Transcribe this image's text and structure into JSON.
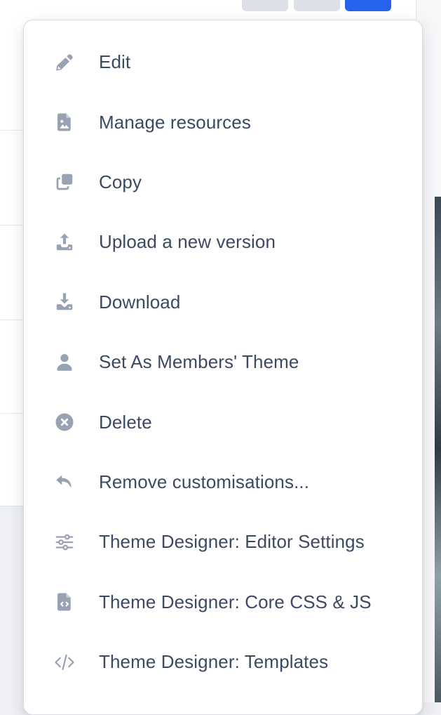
{
  "menu": {
    "items": [
      {
        "label": "Edit",
        "icon": "pencil-icon"
      },
      {
        "label": "Manage resources",
        "icon": "image-file-icon"
      },
      {
        "label": "Copy",
        "icon": "copy-icon"
      },
      {
        "label": "Upload a new version",
        "icon": "upload-icon"
      },
      {
        "label": "Download",
        "icon": "download-icon"
      },
      {
        "label": "Set As Members' Theme",
        "icon": "user-icon"
      },
      {
        "label": "Delete",
        "icon": "close-circle-icon"
      },
      {
        "label": "Remove customisations...",
        "icon": "undo-icon"
      },
      {
        "label": "Theme Designer: Editor Settings",
        "icon": "sliders-icon"
      },
      {
        "label": "Theme Designer: Core CSS & JS",
        "icon": "code-file-icon"
      },
      {
        "label": "Theme Designer: Templates",
        "icon": "code-icon"
      }
    ]
  },
  "colors": {
    "icon": "#98a2b3",
    "text": "#3b4a63",
    "primary": "#2563eb"
  }
}
